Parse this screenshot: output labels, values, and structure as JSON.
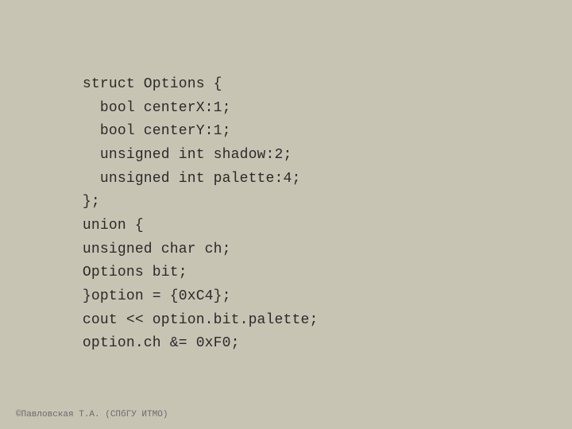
{
  "code": {
    "lines": [
      "    struct Options {",
      "      bool centerX:1;",
      "      bool centerY:1;",
      "      unsigned int shadow:2;",
      "      unsigned int palette:4;",
      "    };",
      "    union {",
      "    unsigned char ch;",
      "    Options bit;",
      "    }option = {0xC4};",
      "    cout << option.bit.palette;",
      "    option.ch &= 0xF0;"
    ],
    "footer": "©Павловская Т.А. (СПбГУ ИТМО)"
  }
}
